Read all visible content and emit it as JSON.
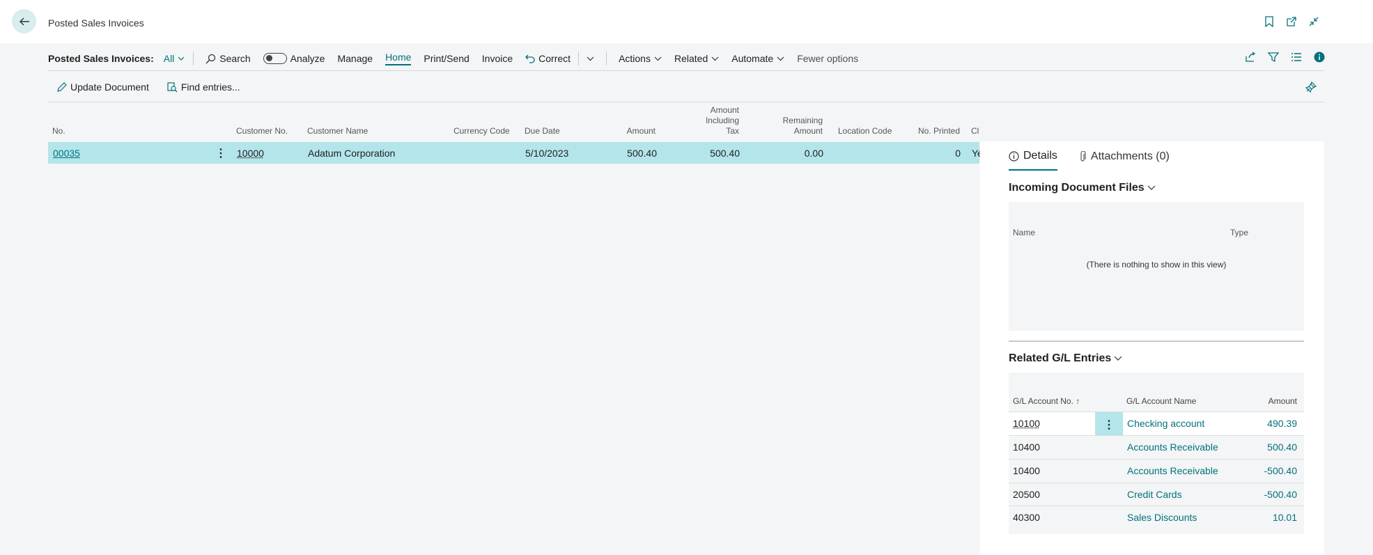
{
  "header": {
    "title": "Posted Sales Invoices"
  },
  "actionbar": {
    "caption": "Posted Sales Invoices:",
    "filter": "All",
    "items": {
      "search": "Search",
      "analyze": "Analyze",
      "manage": "Manage",
      "home": "Home",
      "print_send": "Print/Send",
      "invoice": "Invoice",
      "correct": "Correct",
      "actions": "Actions",
      "related": "Related",
      "automate": "Automate",
      "fewer": "Fewer options"
    }
  },
  "subbar": {
    "update": "Update Document",
    "find": "Find entries..."
  },
  "grid": {
    "headers": {
      "no": "No.",
      "cust_no": "Customer No.",
      "cust_name": "Customer Name",
      "currency": "Currency Code",
      "due": "Due Date",
      "amount": "Amount",
      "amount_incl_1": "Amount Including",
      "amount_incl_2": "Tax",
      "remaining_1": "Remaining",
      "remaining_2": "Amount",
      "location": "Location Code",
      "no_printed": "No. Printed",
      "closed": "Cl"
    },
    "rows": [
      {
        "no": "00035",
        "cust_no": "10000",
        "cust_name": "Adatum Corporation",
        "currency": "",
        "due": "5/10/2023",
        "amount": "500.40",
        "amount_incl": "500.40",
        "remaining": "0.00",
        "location": "",
        "no_printed": "0",
        "closed": "Ye"
      }
    ]
  },
  "factbox": {
    "tabs": {
      "details": "Details",
      "attachments": "Attachments (0)"
    },
    "incoming": {
      "title": "Incoming Document Files",
      "col_name": "Name",
      "col_type": "Type",
      "empty": "(There is nothing to show in this view)"
    },
    "gl": {
      "title": "Related G/L Entries",
      "col_acc": "G/L Account No. ↑",
      "col_name": "G/L Account Name",
      "col_amount": "Amount",
      "rows": [
        {
          "acc": "10100",
          "name": "Checking account",
          "amount": "490.39"
        },
        {
          "acc": "10400",
          "name": "Accounts Receivable",
          "amount": "500.40"
        },
        {
          "acc": "10400",
          "name": "Accounts Receivable",
          "amount": "-500.40"
        },
        {
          "acc": "20500",
          "name": "Credit Cards",
          "amount": "-500.40"
        },
        {
          "acc": "40300",
          "name": "Sales Discounts",
          "amount": "10.01"
        }
      ]
    }
  },
  "colors": {
    "accent": "#00727a",
    "selected_row": "#b3e5ea",
    "back_circle": "#d9ecef"
  }
}
